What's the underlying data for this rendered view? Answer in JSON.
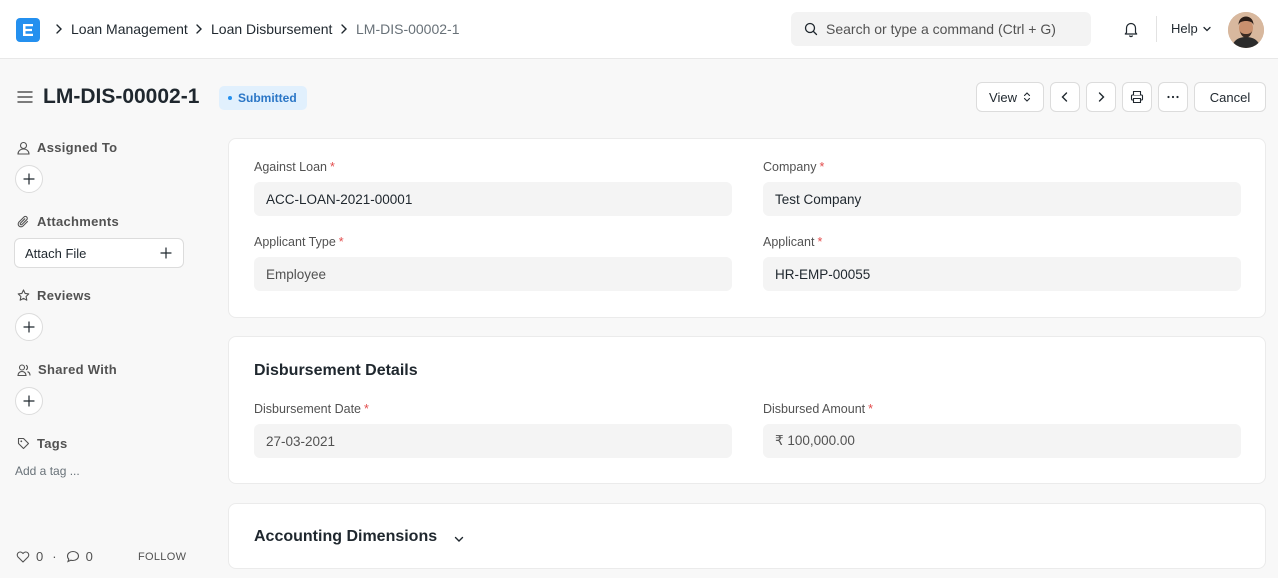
{
  "breadcrumbs": [
    "Loan Management",
    "Loan Disbursement",
    "LM-DIS-00002-1"
  ],
  "search": {
    "placeholder": "Search or type a command (Ctrl + G)"
  },
  "nav": {
    "help_label": "Help"
  },
  "page": {
    "title": "LM-DIS-00002-1",
    "status": "Submitted",
    "view_label": "View",
    "cancel_label": "Cancel"
  },
  "sidebar": {
    "assigned_to": "Assigned To",
    "attachments": "Attachments",
    "attach_file": "Attach File",
    "reviews": "Reviews",
    "shared_with": "Shared With",
    "tags": "Tags",
    "add_tag": "Add a tag ...",
    "likes": "0",
    "comments": "0",
    "follow": "FOLLOW"
  },
  "form": {
    "against_loan": {
      "label": "Against Loan",
      "value": "ACC-LOAN-2021-00001"
    },
    "company": {
      "label": "Company",
      "value": "Test Company"
    },
    "applicant_type": {
      "label": "Applicant Type",
      "value": "Employee"
    },
    "applicant": {
      "label": "Applicant",
      "value": "HR-EMP-00055"
    },
    "disbursement_section": "Disbursement Details",
    "disbursement_date": {
      "label": "Disbursement Date",
      "value": "27-03-2021"
    },
    "disbursed_amount": {
      "label": "Disbursed Amount",
      "value": "₹ 100,000.00"
    },
    "accounting_section": "Accounting Dimensions"
  },
  "colors": {
    "accent": "#2490ef",
    "required": "#e24c4c",
    "badge_bg": "#e1f0fd",
    "badge_text": "#2a76c6"
  }
}
